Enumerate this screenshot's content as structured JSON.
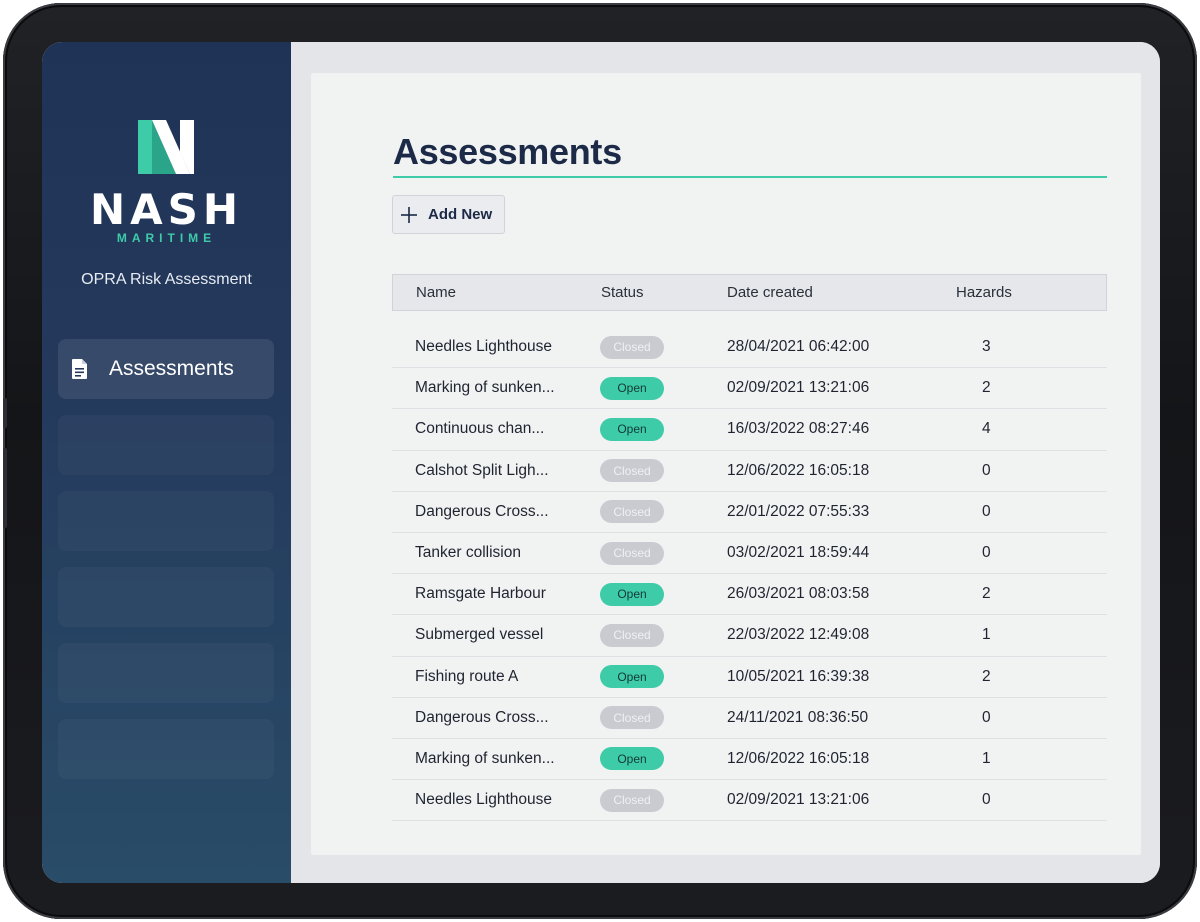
{
  "brand": {
    "name": "NASH",
    "sub": "MARITIME",
    "app_subtitle": "OPRA Risk Assessment"
  },
  "nav": {
    "items": [
      {
        "label": "Assessments",
        "icon": "document-icon"
      }
    ]
  },
  "page": {
    "title": "Assessments",
    "add_label": "Add New"
  },
  "table": {
    "headers": {
      "name": "Name",
      "status": "Status",
      "date": "Date created",
      "hazards": "Hazards"
    },
    "rows": [
      {
        "name": "Needles Lighthouse",
        "status": "Closed",
        "date": "28/04/2021 06:42:00",
        "hazards": "3"
      },
      {
        "name": "Marking of sunken...",
        "status": "Open",
        "date": "02/09/2021 13:21:06",
        "hazards": "2"
      },
      {
        "name": "Continuous chan...",
        "status": "Open",
        "date": "16/03/2022 08:27:46",
        "hazards": "4"
      },
      {
        "name": "Calshot Split Ligh...",
        "status": "Closed",
        "date": "12/06/2022 16:05:18",
        "hazards": "0"
      },
      {
        "name": "Dangerous Cross...",
        "status": "Closed",
        "date": "22/01/2022 07:55:33",
        "hazards": "0"
      },
      {
        "name": "Tanker collision",
        "status": "Closed",
        "date": "03/02/2021 18:59:44",
        "hazards": "0"
      },
      {
        "name": "Ramsgate Harbour",
        "status": "Open",
        "date": "26/03/2021 08:03:58",
        "hazards": "2"
      },
      {
        "name": "Submerged vessel",
        "status": "Closed",
        "date": "22/03/2022 12:49:08",
        "hazards": "1"
      },
      {
        "name": "Fishing route A",
        "status": "Open",
        "date": "10/05/2021 16:39:38",
        "hazards": "2"
      },
      {
        "name": "Dangerous Cross...",
        "status": "Closed",
        "date": "24/11/2021 08:36:50",
        "hazards": "0"
      },
      {
        "name": "Marking of sunken...",
        "status": "Open",
        "date": "12/06/2022 16:05:18",
        "hazards": "1"
      },
      {
        "name": "Needles Lighthouse",
        "status": "Closed",
        "date": "02/09/2021 13:21:06",
        "hazards": "0"
      }
    ]
  },
  "colors": {
    "accent": "#3ecba8",
    "sidebar": "#1f3357",
    "title": "#1c2a47",
    "closed_badge": "#c9cbd1"
  }
}
